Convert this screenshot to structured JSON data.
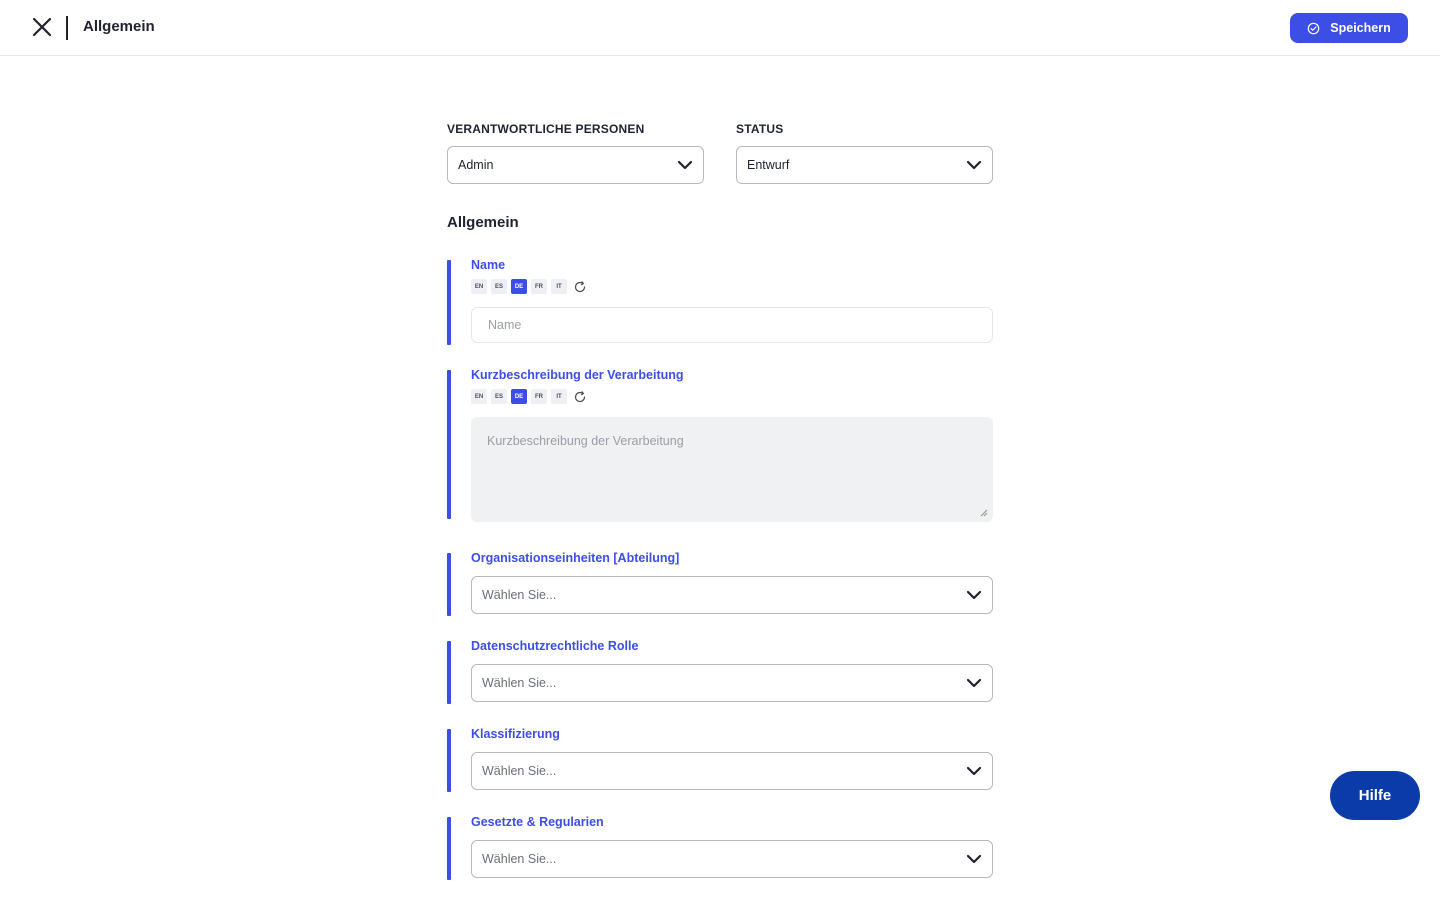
{
  "header": {
    "title": "Allgemein",
    "save_label": "Speichern",
    "close_icon": "close-icon",
    "save_icon": "check-circle-icon"
  },
  "top_fields": {
    "persons": {
      "label": "VERANTWORTLICHE PERSONEN",
      "value": "Admin"
    },
    "status": {
      "label": "STATUS",
      "value": "Entwurf"
    }
  },
  "section": {
    "title": "Allgemein"
  },
  "languages": [
    "EN",
    "ES",
    "DE",
    "FR",
    "IT"
  ],
  "active_language": "DE",
  "fields": {
    "name": {
      "label": "Name",
      "placeholder": "Name"
    },
    "description": {
      "label": "Kurzbeschreibung der Verarbeitung",
      "placeholder": "Kurzbeschreibung der Verarbeitung"
    },
    "org_units": {
      "label": "Organisationseinheiten [Abteilung]",
      "placeholder": "Wählen Sie..."
    },
    "privacy_role": {
      "label": "Datenschutzrechtliche Rolle",
      "placeholder": "Wählen Sie..."
    },
    "classification": {
      "label": "Klassifizierung",
      "placeholder": "Wählen Sie..."
    },
    "laws": {
      "label": "Gesetzte & Regularien",
      "placeholder": "Wählen Sie..."
    }
  },
  "help": {
    "label": "Hilfe"
  },
  "colors": {
    "accent": "#3d4ee6",
    "help": "#0b3ba8",
    "text": "#1f2330"
  }
}
